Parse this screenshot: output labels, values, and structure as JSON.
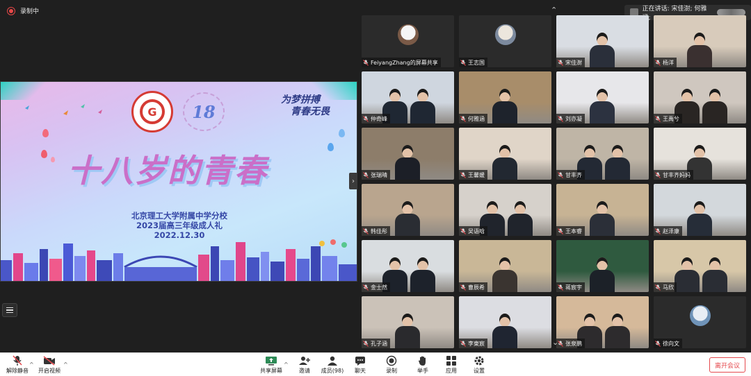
{
  "recording": {
    "label": "录制中"
  },
  "speaking": {
    "label": "正在讲话: 宋佳澍; 何雅涵;"
  },
  "shared_screen": {
    "slogan_line1": "为梦拼搏",
    "slogan_line2": "青春无畏",
    "logo_number": "18",
    "hero_title": "十八岁的青春",
    "school_line1": "北京理工大学附属中学分校",
    "school_line2": "2023届高三年级成人礼",
    "date": "2022.12.30"
  },
  "participants": [
    {
      "name": "FeiyangZhang的屏幕共享",
      "type": "avatar",
      "colors": [
        "#f5f5f5",
        "#7a5a47"
      ]
    },
    {
      "name": "王志国",
      "type": "avatar",
      "colors": [
        "#ece6dd",
        "#7c8a9e"
      ]
    },
    {
      "name": "宋佳澍",
      "type": "video",
      "active": true,
      "colors": [
        "#d9dde3",
        "#2a2f3a"
      ]
    },
    {
      "name": "杨洋",
      "type": "video",
      "colors": [
        "#d8cbbb",
        "#3a3030"
      ]
    },
    {
      "name": "仲奇峰",
      "type": "video",
      "colors": [
        "#cfd6df",
        "#1f2733"
      ]
    },
    {
      "name": "何雅涵",
      "type": "video",
      "colors": [
        "#a88d6a",
        "#1e232c"
      ]
    },
    {
      "name": "刘亦凝",
      "type": "video",
      "colors": [
        "#e7e7ea",
        "#2c3240"
      ]
    },
    {
      "name": "王禹兮",
      "type": "video",
      "colors": [
        "#cfc7bf",
        "#292523"
      ]
    },
    {
      "name": "张瑞晴",
      "type": "video",
      "colors": [
        "#8d7d6a",
        "#1c1f27"
      ]
    },
    {
      "name": "王馨媛",
      "type": "video",
      "colors": [
        "#e0d5c8",
        "#222831"
      ]
    },
    {
      "name": "甘丰齐",
      "type": "video",
      "colors": [
        "#bfb5a6",
        "#232934"
      ]
    },
    {
      "name": "甘丰齐妈妈",
      "type": "video",
      "colors": [
        "#e6e2dc",
        "#333"
      ]
    },
    {
      "name": "韩佳彤",
      "type": "video",
      "colors": [
        "#b9a58e",
        "#2a2d33"
      ]
    },
    {
      "name": "吴语晗",
      "type": "video",
      "colors": [
        "#d6d1cb",
        "#20242c"
      ]
    },
    {
      "name": "王本睿",
      "type": "video",
      "colors": [
        "#c7b394",
        "#2b2f38"
      ]
    },
    {
      "name": "赵泽康",
      "type": "video",
      "colors": [
        "#d3d8dc",
        "#262d38"
      ]
    },
    {
      "name": "金士然",
      "type": "video",
      "colors": [
        "#d9dde0",
        "#1d222b"
      ]
    },
    {
      "name": "曹辰希",
      "type": "video",
      "colors": [
        "#c9b797",
        "#3a3430"
      ]
    },
    {
      "name": "蒋宸宇",
      "type": "video",
      "colors": [
        "#2f5a3f",
        "#1c2128"
      ]
    },
    {
      "name": "马欣",
      "type": "video",
      "colors": [
        "#d7c7a8",
        "#2a2d34"
      ]
    },
    {
      "name": "孔子涵",
      "type": "video",
      "colors": [
        "#cbc2b8",
        "#2a2a2d"
      ]
    },
    {
      "name": "李東宸",
      "type": "video",
      "colors": [
        "#dcdde2",
        "#1f2531"
      ]
    },
    {
      "name": "张泉鹏",
      "type": "video",
      "colors": [
        "#d5b99a",
        "#2d2b2d"
      ]
    },
    {
      "name": "徐向文",
      "type": "avatar",
      "colors": [
        "#e8eef5",
        "#6f93b8"
      ]
    }
  ],
  "toolbar": {
    "unmute": "解除静音",
    "start_video": "开启视频",
    "share_screen": "共享屏幕",
    "invite": "邀请",
    "members": "成员(98)",
    "chat": "聊天",
    "record": "录制",
    "raise_hand": "举手",
    "apps": "应用",
    "settings": "设置",
    "leave": "离开会议"
  },
  "colors": {
    "active_speaker": "#39b54a",
    "leave": "#e5484d",
    "record": "#e64848",
    "share_icon": "#2e8b57"
  }
}
